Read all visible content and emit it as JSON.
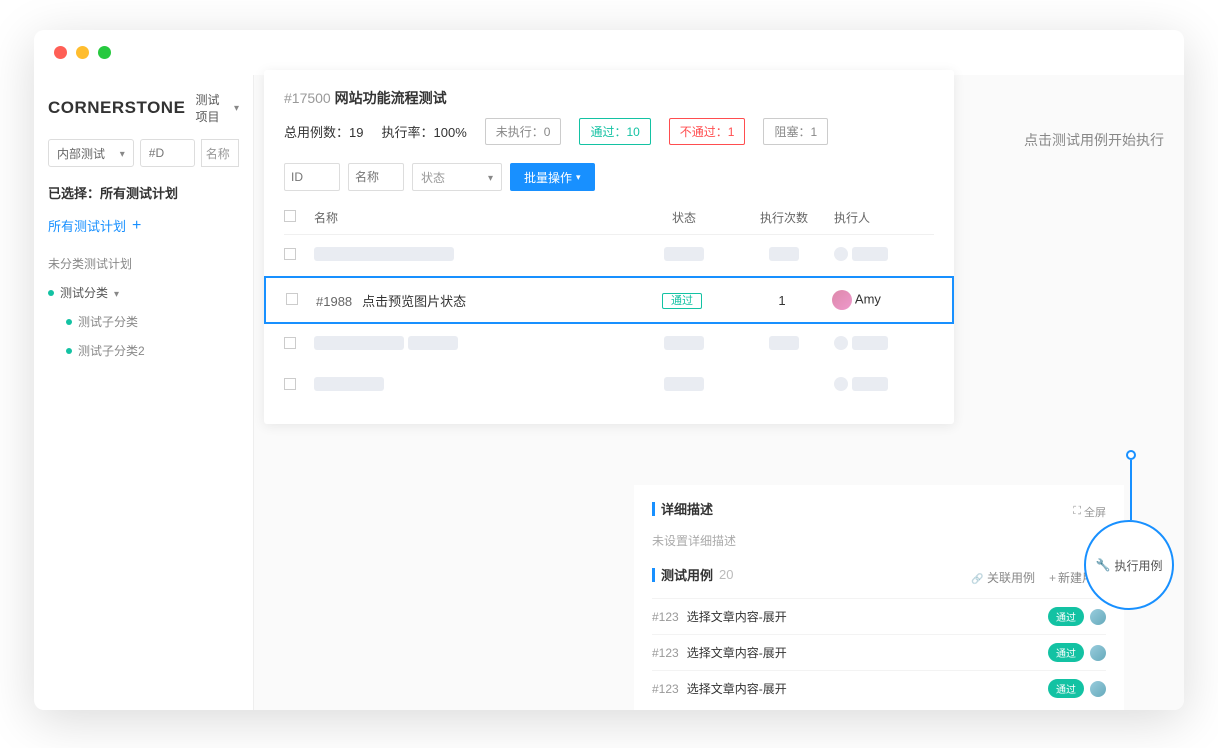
{
  "brand": "CORNERSTONE",
  "project_label": "测试项目",
  "sidebar": {
    "filter_select": "内部测试",
    "id_placeholder": "#D",
    "name_placeholder": "名称",
    "selected_label": "已选择：所有测试计划",
    "all_plans": "所有测试计划",
    "uncategorized": "未分类测试计划",
    "category": "测试分类",
    "children": [
      "测试子分类",
      "测试子分类2"
    ]
  },
  "panel": {
    "task_id": "#17500",
    "task_name": "网站功能流程测试",
    "total_label": "总用例数：",
    "total_val": "19",
    "rate_label": "执行率：",
    "rate_val": "100%",
    "not_run": "未执行：0",
    "pass": "通过：10",
    "fail": "不通过：1",
    "block": "阻塞：1",
    "filter_id": "ID",
    "filter_name": "名称",
    "filter_status": "状态",
    "batch_btn": "批量操作",
    "cols": {
      "name": "名称",
      "status": "状态",
      "count": "执行次数",
      "exec": "执行人"
    },
    "selected_row": {
      "id": "#1988",
      "name": "点击预览图片状态",
      "status": "通过",
      "count": "1",
      "user": "Amy"
    }
  },
  "side_hint": "点击测试用例开始执行",
  "lower": {
    "detail_title": "详细描述",
    "detail_empty": "未设置详细描述",
    "cases_title": "测试用例",
    "cases_count": "20",
    "link_case": "关联用例",
    "new_case": "新建用例",
    "fullscreen": "全屏",
    "items": [
      {
        "id": "#123",
        "name": "选择文章内容-展开",
        "status": "通过"
      },
      {
        "id": "#123",
        "name": "选择文章内容-展开",
        "status": "通过"
      },
      {
        "id": "#123",
        "name": "选择文章内容-展开",
        "status": "通过"
      }
    ]
  },
  "callout": "执行用例"
}
